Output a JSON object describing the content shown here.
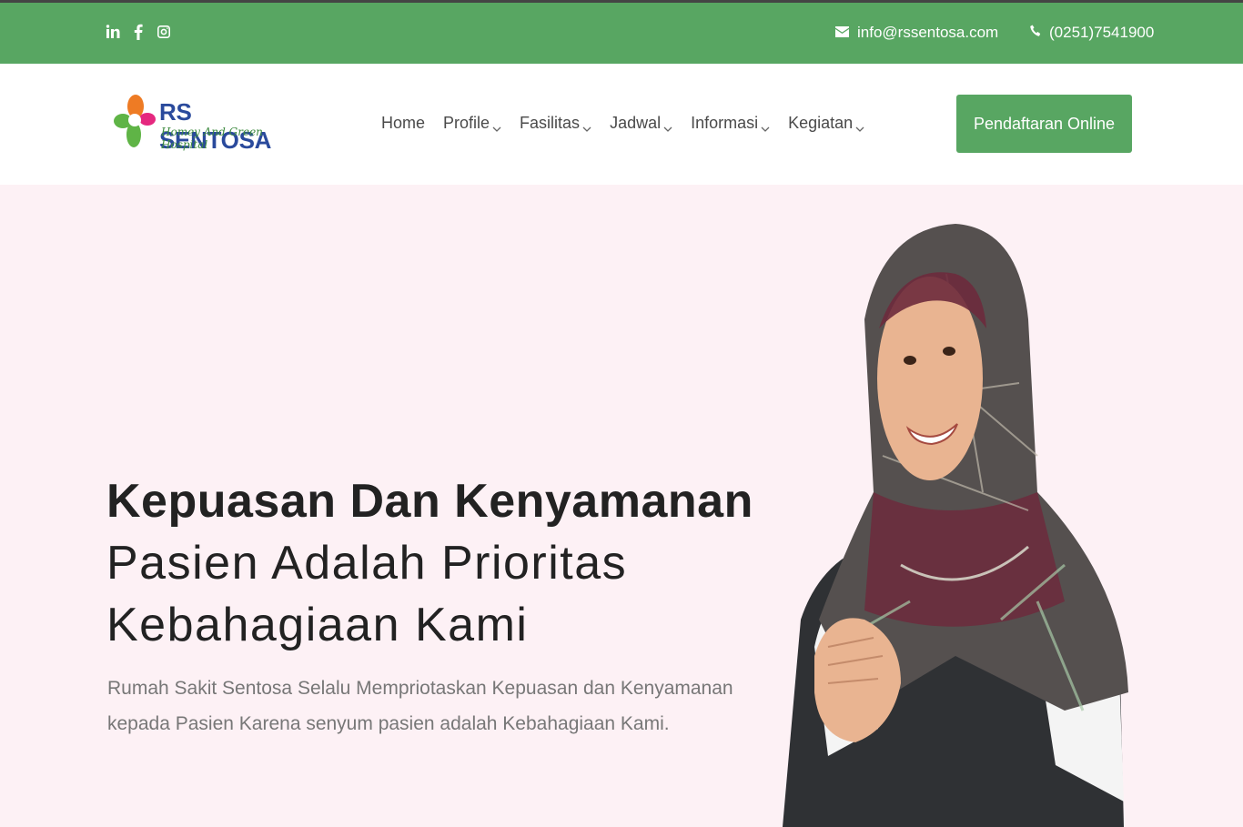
{
  "topbar": {
    "social_icons": [
      "linkedin-icon",
      "facebook-icon",
      "instagram-icon"
    ],
    "email": "info@rssentosa.com",
    "phone": "(0251)7541900"
  },
  "navbar": {
    "logo": {
      "title": "RS SENTOSA",
      "tagline": "Homey And Green Hospital"
    },
    "menu": [
      {
        "label": "Home",
        "dropdown": false
      },
      {
        "label": "Profile",
        "dropdown": true
      },
      {
        "label": "Fasilitas",
        "dropdown": true
      },
      {
        "label": "Jadwal",
        "dropdown": true
      },
      {
        "label": "Informasi",
        "dropdown": true
      },
      {
        "label": "Kegiatan",
        "dropdown": true
      }
    ],
    "cta_label": "Pendaftaran Online"
  },
  "hero": {
    "heading_bold": "Kepuasan Dan Kenyamanan",
    "heading_line2": "Pasien Adalah Prioritas",
    "heading_line3": "Kebahagiaan Kami",
    "subtitle": "Rumah Sakit Sentosa Selalu Mempriotaskan Kepuasan dan Kenyamanan kepada Pasien Karena senyum pasien adalah Kebahagiaan Kami."
  },
  "colors": {
    "brand_green": "#58a662",
    "hero_bg": "#fdf1f5",
    "logo_blue": "#2a4a9c"
  }
}
